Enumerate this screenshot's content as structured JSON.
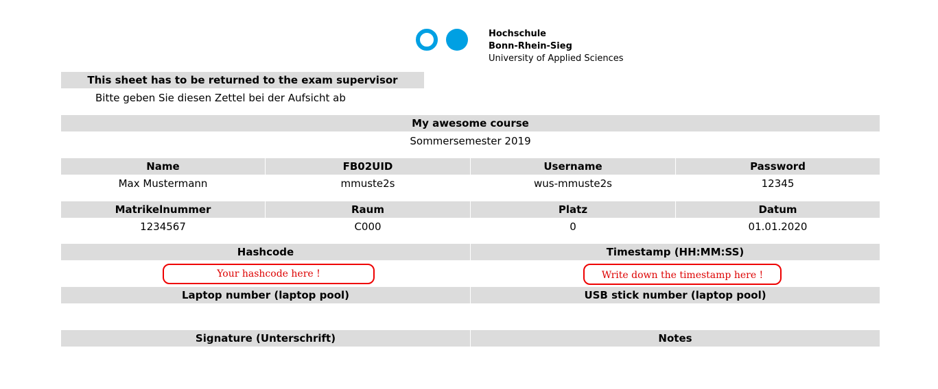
{
  "logo": {
    "line1": "Hochschule",
    "line2": "Bonn-Rhein-Sieg",
    "line3": "University of Applied Sciences",
    "color": "#00a0e3"
  },
  "notice": {
    "en": "This sheet has to be returned to the exam supervisor",
    "de": "Bitte geben Sie diesen Zettel bei der Aufsicht ab"
  },
  "course": {
    "title": "My awesome course",
    "semester": "Sommersemester 2019"
  },
  "row1": {
    "headers": [
      "Name",
      "FB02UID",
      "Username",
      "Password"
    ],
    "values": [
      "Max Mustermann",
      "mmuste2s",
      "wus-mmuste2s",
      "12345"
    ]
  },
  "row2": {
    "headers": [
      "Matrikelnummer",
      "Raum",
      "Platz",
      "Datum"
    ],
    "values": [
      "1234567",
      "C000",
      "0",
      "01.01.2020"
    ]
  },
  "row3": {
    "headers": [
      "Hashcode",
      "Timestamp (HH:MM:SS)"
    ],
    "placeholders": [
      "Your hashcode here !",
      "Write down the timestamp here !"
    ]
  },
  "row4": {
    "headers": [
      "Laptop number (laptop pool)",
      "USB stick number (laptop pool)"
    ]
  },
  "row5": {
    "headers": [
      "Signature (Unterschrift)",
      "Notes"
    ]
  }
}
